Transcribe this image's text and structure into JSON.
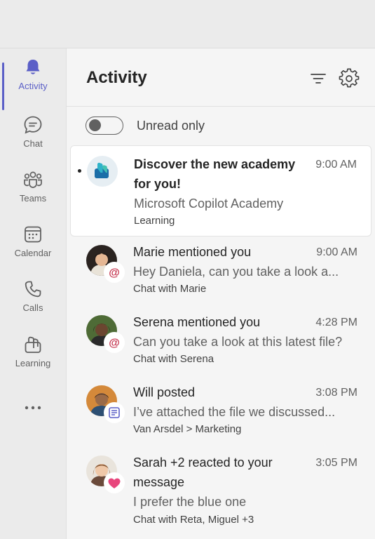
{
  "rail": {
    "items": [
      {
        "label": "Activity",
        "icon": "bell-icon"
      },
      {
        "label": "Chat",
        "icon": "chat-icon"
      },
      {
        "label": "Teams",
        "icon": "teams-icon"
      },
      {
        "label": "Calendar",
        "icon": "calendar-icon"
      },
      {
        "label": "Calls",
        "icon": "phone-icon"
      },
      {
        "label": "Learning",
        "icon": "learning-icon"
      }
    ],
    "more_icon": "more-icon"
  },
  "activity": {
    "title": "Activity",
    "filter_icon": "filter-icon",
    "settings_icon": "gear-icon",
    "unread_toggle": {
      "label": "Unread only",
      "on": false
    }
  },
  "feed": [
    {
      "title_l1": "Discover the new academy",
      "title_l2": "for you!",
      "time": "9:00 AM",
      "preview": "Microsoft Copilot Academy",
      "context": "Learning",
      "unread": true,
      "badge": "none"
    },
    {
      "title": "Marie mentioned you",
      "time": "9:00 AM",
      "preview": "Hey Daniela, can you take a look a...",
      "context": "Chat with Marie",
      "badge": "mention-icon"
    },
    {
      "title": "Serena mentioned you",
      "time": "4:28 PM",
      "preview": "Can you take a look at this latest file?",
      "context": "Chat with Serena",
      "badge": "mention-icon"
    },
    {
      "title": "Will posted",
      "time": "3:08 PM",
      "preview": "I’ve attached the file we discussed...",
      "context": "Van Arsdel > Marketing",
      "badge": "post-icon"
    },
    {
      "title_l1": "Sarah +2 reacted to your",
      "title_l2": "message",
      "time": "3:05 PM",
      "preview": "I prefer the blue one",
      "context": "Chat with Reta, Miguel +3",
      "badge": "heart-icon"
    }
  ],
  "colors": {
    "accent": "#5b5fc7",
    "mention": "#c4314b",
    "heart": "#e8467c"
  }
}
